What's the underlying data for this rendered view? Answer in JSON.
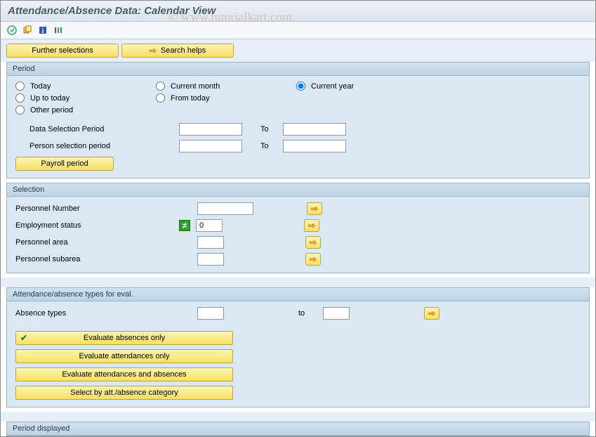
{
  "title": "Attendance/Absence Data: Calendar View",
  "watermark": "© www.tutorialkart.com",
  "toolbar": {
    "icons": [
      "execute",
      "stack",
      "info",
      "layout"
    ]
  },
  "buttons": {
    "further_selections": "Further selections",
    "search_helps": "Search helps",
    "payroll_period": "Payroll period"
  },
  "period": {
    "header": "Period",
    "options": {
      "today": "Today",
      "current_month": "Current month",
      "current_year": "Current year",
      "up_to_today": "Up to today",
      "from_today": "From today",
      "other_period": "Other period"
    },
    "selected": "current_year",
    "data_selection_label": "Data Selection Period",
    "person_selection_label": "Person selection period",
    "to_label": "To",
    "data_from": "",
    "data_to": "",
    "person_from": "",
    "person_to": ""
  },
  "selection": {
    "header": "Selection",
    "personnel_number_label": "Personnel Number",
    "personnel_number_value": "",
    "employment_status_label": "Employment status",
    "employment_status_value": "0",
    "personnel_area_label": "Personnel area",
    "personnel_area_value": "",
    "personnel_subarea_label": "Personnel subarea",
    "personnel_subarea_value": ""
  },
  "absence": {
    "header": "Attendance/absence types for eval.",
    "absence_types_label": "Absence types",
    "absence_from": "",
    "to_label": "to",
    "absence_to": "",
    "eval_absences_only": "Evaluate absences only",
    "eval_attendances_only": "Evaluate attendances only",
    "eval_both": "Evaluate attendances and absences",
    "select_by_category": "Select by att./absence category"
  },
  "period_displayed": {
    "header": "Period displayed"
  }
}
